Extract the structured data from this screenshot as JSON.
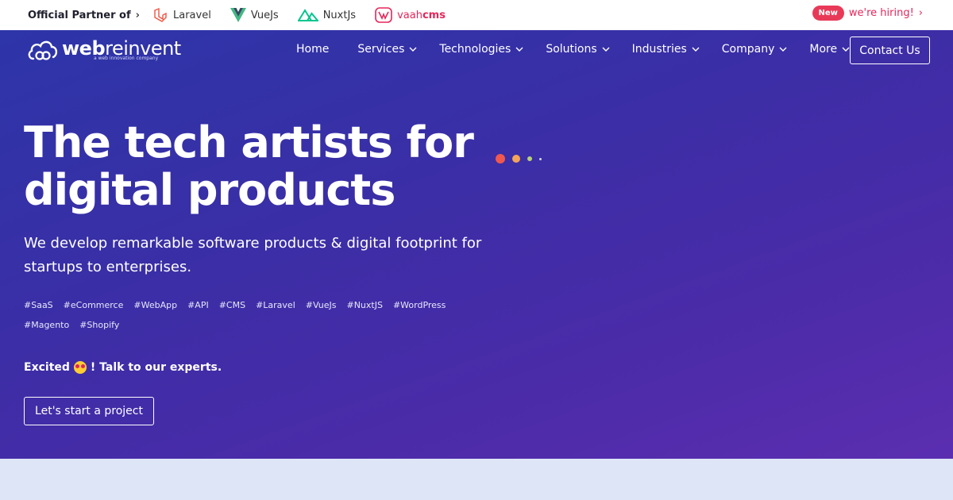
{
  "topbar": {
    "partner_label": "Official Partner of",
    "partners": [
      {
        "name": "Laravel",
        "icon": "laravel-icon",
        "color": "#f05340"
      },
      {
        "name": "VueJs",
        "icon": "vuejs-icon",
        "color": "#41b883"
      },
      {
        "name": "NuxtJs",
        "icon": "nuxtjs-icon",
        "color": "#00c58e"
      },
      {
        "name_prefix": "vaah",
        "name_suffix": "cms",
        "icon": "vaahcms-icon",
        "color": "#e5265a"
      }
    ],
    "new_badge": "New",
    "hiring_text": "we're hiring!"
  },
  "nav": {
    "logo_bold": "web",
    "logo_light": "reinvent",
    "logo_tagline": "a web innovation company",
    "items": [
      {
        "label": "Home",
        "dropdown": false
      },
      {
        "label": "Services",
        "dropdown": true
      },
      {
        "label": "Technologies",
        "dropdown": true
      },
      {
        "label": "Solutions",
        "dropdown": true
      },
      {
        "label": "Industries",
        "dropdown": true
      },
      {
        "label": "Company",
        "dropdown": true
      },
      {
        "label": "More",
        "dropdown": true
      }
    ],
    "contact_label": "Contact Us"
  },
  "hero": {
    "headline_line1": "The tech artists for",
    "headline_line2": "digital products",
    "subtext": "We develop remarkable software products & digital footprint for startups to enterprises.",
    "tags": [
      "#SaaS",
      "#eCommerce",
      "#WebApp",
      "#API",
      "#CMS",
      "#Laravel",
      "#VueJs",
      "#NuxtJS",
      "#WordPress",
      "#Magento",
      "#Shopify"
    ],
    "excited_prefix": "Excited",
    "excited_suffix": "! Talk to our experts.",
    "cta_label": "Let's start a project",
    "dots": [
      {
        "color": "#f0584f",
        "size": 12
      },
      {
        "color": "#f4a35a",
        "size": 10
      },
      {
        "color": "#b7d07a",
        "size": 6
      },
      {
        "color": "#d0d4f0",
        "size": 3
      }
    ]
  },
  "colors": {
    "accent": "#e5265a",
    "hero_start": "#2d35a8",
    "hero_end": "#5b2eb0",
    "lower_bg": "#dde5f7"
  }
}
